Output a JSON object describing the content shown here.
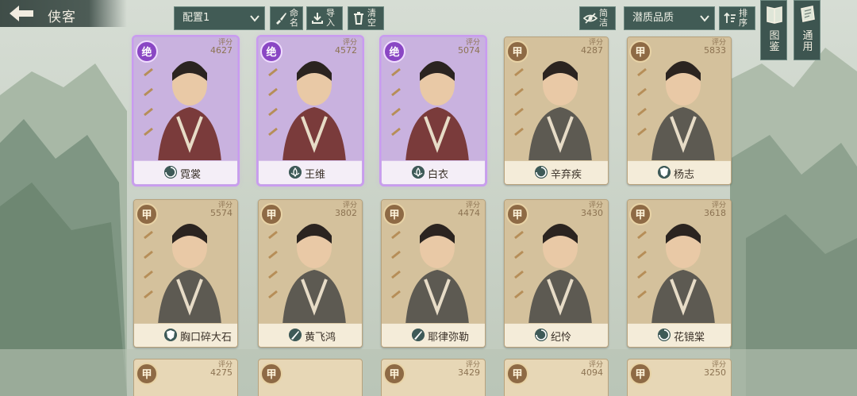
{
  "header": {
    "title": "侠客"
  },
  "toolbar": {
    "config_select": "配置1",
    "rename_label": [
      "命",
      "名"
    ],
    "import_label": [
      "导",
      "入"
    ],
    "clear_label": [
      "清",
      "空"
    ],
    "simple_label": [
      "简",
      "洁"
    ],
    "sort_select": "潜质品质",
    "sort_label": [
      "排",
      "序"
    ]
  },
  "side": {
    "atlas_label": [
      "图",
      "鉴"
    ],
    "general_label": [
      "通",
      "用"
    ]
  },
  "score_label": "评分",
  "cards": [
    {
      "name": "霓裳",
      "tier": "绝",
      "score": "4627",
      "score_partial": "27",
      "cls": "swirl"
    },
    {
      "name": "王维",
      "tier": "绝",
      "score": "4572",
      "cls": "lotus"
    },
    {
      "name": "白衣",
      "tier": "绝",
      "score": "5074",
      "cls": "lotus"
    },
    {
      "name": "辛弃疾",
      "tier": "甲",
      "score": "4287",
      "cls": "swirl"
    },
    {
      "name": "杨志",
      "tier": "甲",
      "score": "5833",
      "cls": "shield"
    },
    {
      "name": "胸口碎大石",
      "tier": "甲",
      "score": "5574",
      "cls": "shield"
    },
    {
      "name": "黄飞鸿",
      "tier": "甲",
      "score": "3802",
      "cls": "blade"
    },
    {
      "name": "耶律弥勒",
      "tier": "甲",
      "score": "4474",
      "cls": "blade"
    },
    {
      "name": "纪怜",
      "tier": "甲",
      "score": "3430",
      "cls": "swirl"
    },
    {
      "name": "花镜棠",
      "tier": "甲",
      "score": "3618",
      "cls": "swirl"
    }
  ],
  "bottom_cards": [
    {
      "tier": "甲",
      "score": "4275"
    },
    {
      "tier": "甲",
      "score": ""
    },
    {
      "tier": "甲",
      "score": "3429"
    },
    {
      "tier": "甲",
      "score": "4094"
    },
    {
      "tier": "甲",
      "score": "3250"
    }
  ],
  "colors": {
    "jue_accent": "#8a47c4",
    "jia_accent": "#8e6a45",
    "ui_teal": "#415b55"
  }
}
